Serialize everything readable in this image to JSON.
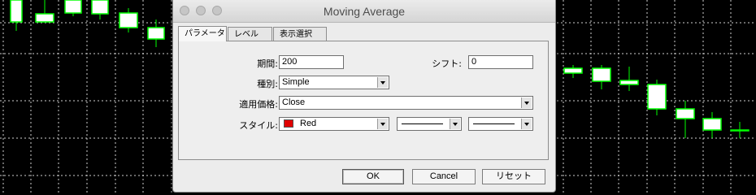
{
  "window": {
    "title": "Moving Average",
    "close_color": "#c6c6c6"
  },
  "tabs": [
    {
      "label": "パラメータ",
      "active": true
    },
    {
      "label": "レベル",
      "active": false
    },
    {
      "label": "表示選択",
      "active": false
    }
  ],
  "params": {
    "period_label": "期間:",
    "period_value": "200",
    "shift_label": "シフト:",
    "shift_value": "0",
    "type_label": "種別:",
    "type_value": "Simple",
    "apply_label": "適用価格:",
    "apply_value": "Close",
    "style_label": "スタイル:",
    "color_value": "Red",
    "color_hex": "#e00000"
  },
  "buttons": {
    "ok": "OK",
    "cancel": "Cancel",
    "reset": "リセット"
  },
  "chart": {
    "background": "#000000",
    "grid_color": "#d0d0d0",
    "candle_color": "#00ff00"
  }
}
